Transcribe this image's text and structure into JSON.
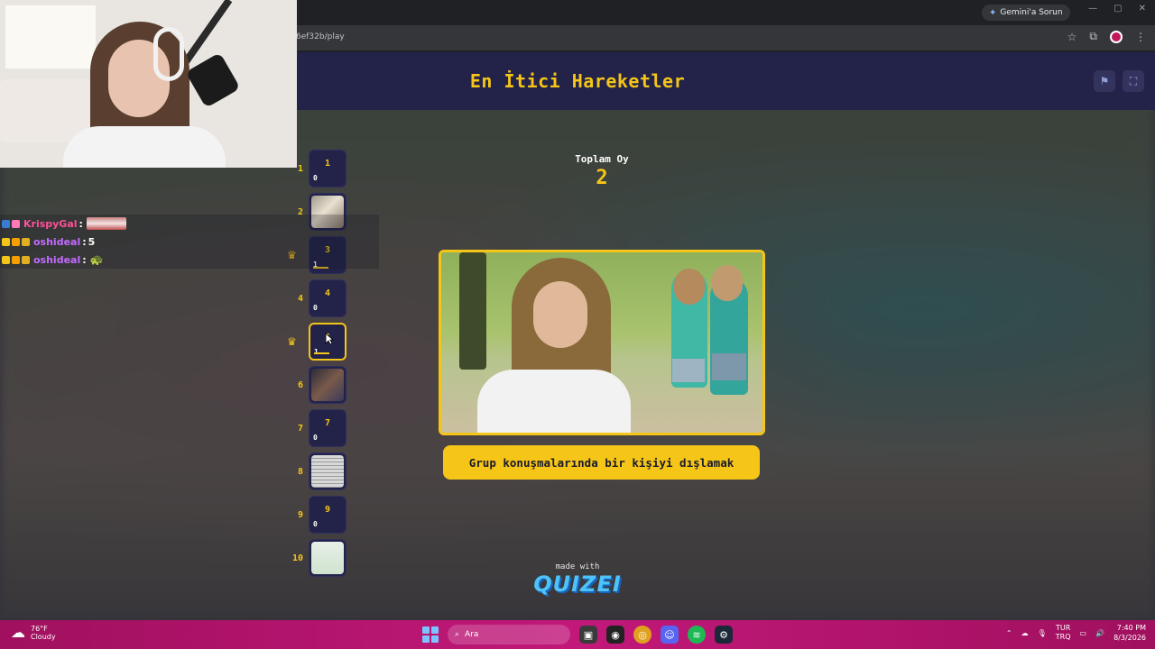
{
  "browser": {
    "gemini_label": "Gemini'a Sorun",
    "url": "6ef32b/play"
  },
  "quiz": {
    "title": "En İtici Hareketler",
    "total_votes_label": "Toplam Oy",
    "total_votes": "2",
    "caption": "Grup konuşmalarında bir kişiyi dışlamak",
    "made_with": "made with",
    "brand": "QUIZEI"
  },
  "ranking": [
    {
      "index": "1",
      "votes": "0",
      "fill": 0
    },
    {
      "index": "2",
      "votes": "",
      "thumbnail": true
    },
    {
      "index": "3",
      "votes": "1",
      "fill": 0.5,
      "crown": true
    },
    {
      "index": "4",
      "votes": "0",
      "fill": 0
    },
    {
      "index": "5",
      "votes": "1",
      "fill": 0.5,
      "crown": true,
      "active": true
    },
    {
      "index": "6",
      "votes": "",
      "thumbnail": true
    },
    {
      "index": "7",
      "votes": "0",
      "fill": 0
    },
    {
      "index": "8",
      "votes": "",
      "thumbnail": true
    },
    {
      "index": "9",
      "votes": "0",
      "fill": 0
    },
    {
      "index": "10",
      "votes": "",
      "thumbnail": true
    }
  ],
  "chat": [
    {
      "name": "KrispyGal",
      "name_color": "#ff4f9a",
      "separator": ":",
      "message": "",
      "emote": "wide"
    },
    {
      "name": "oshideal",
      "name_color": "#c46bff",
      "separator": ":",
      "message": "5"
    },
    {
      "name": "oshideal",
      "name_color": "#c46bff",
      "separator": ":",
      "message": "",
      "emote": "small"
    }
  ],
  "taskbar": {
    "temperature": "76°F",
    "weather": "Cloudy",
    "search_placeholder": "Ara",
    "lang_top": "TUR",
    "lang_bottom": "TRQ",
    "time": "7:40 PM",
    "date": "8/3/2026"
  },
  "colors": {
    "accent": "#f5c518",
    "header_bg": "#23234a",
    "taskbar": "#c2187a"
  }
}
